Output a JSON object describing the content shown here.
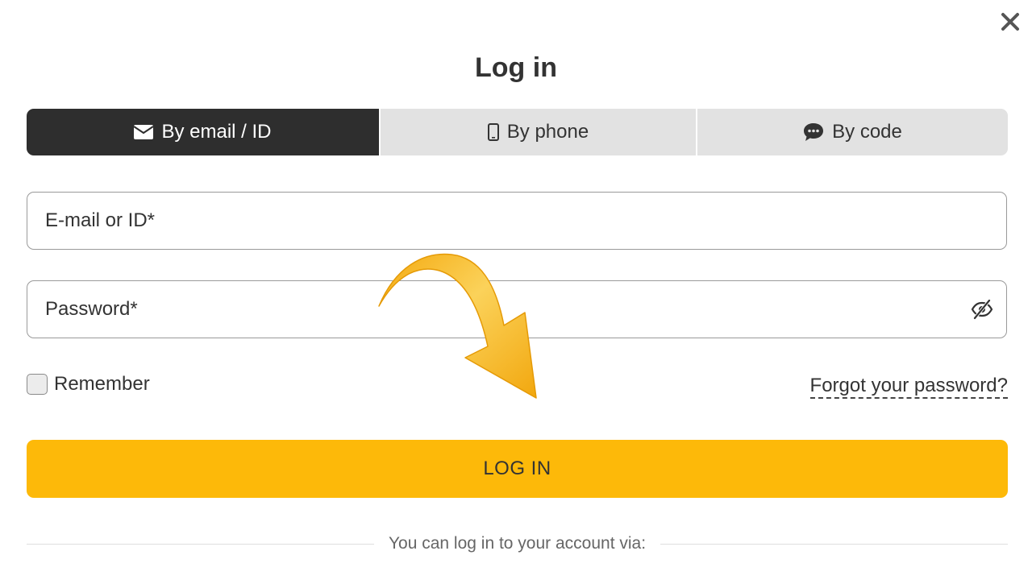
{
  "dialog": {
    "title": "Log in",
    "close_icon": "close-icon"
  },
  "tabs": [
    {
      "label": "By email / ID",
      "icon": "envelope-icon",
      "active": true
    },
    {
      "label": "By phone",
      "icon": "mobile-phone-icon",
      "active": false
    },
    {
      "label": "By code",
      "icon": "chat-bubble-icon",
      "active": false
    }
  ],
  "form": {
    "email": {
      "placeholder": "E-mail or ID*",
      "value": ""
    },
    "password": {
      "placeholder": "Password*",
      "value": "",
      "toggle_icon": "eye-slash-icon"
    },
    "remember_label": "Remember",
    "remember_checked": false,
    "forgot_label": "Forgot your password?",
    "submit_label": "LOG IN",
    "alt_login_text": "You can log in to your account via:"
  },
  "overlay": {
    "arrow_icon": "curved-arrow-icon"
  },
  "colors": {
    "accent": "#fdb909",
    "active_tab": "#2e2e2e",
    "inactive_tab": "#e2e2e2",
    "text": "#333333",
    "arrow": "#f5b51c"
  }
}
